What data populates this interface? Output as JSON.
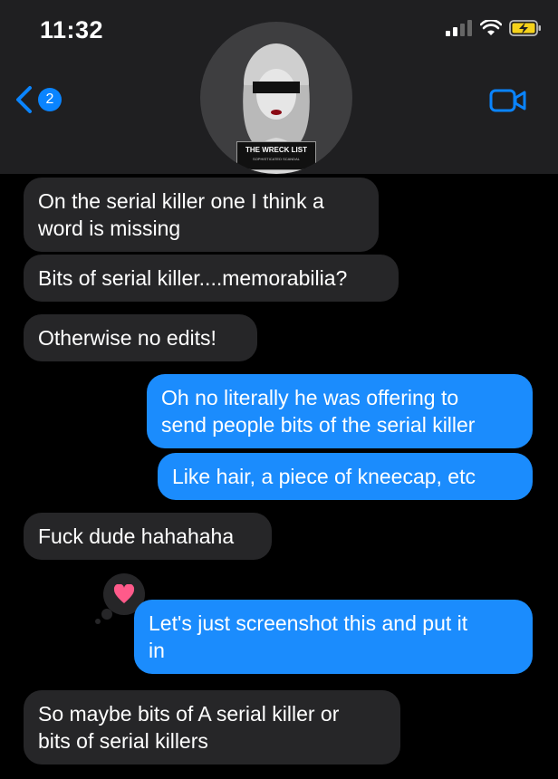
{
  "status_bar": {
    "time": "11:32"
  },
  "nav": {
    "unread_count": "2"
  },
  "contact": {
    "avatar_title": "THE WRECK LIST",
    "avatar_subtitle": "SOPHISTICATED SCANDAL"
  },
  "messages": [
    {
      "sender": "them",
      "text": "On the serial killer one I think a\nword is missing"
    },
    {
      "sender": "them",
      "text": "Bits of serial killer....memorabilia?"
    },
    {
      "sender": "them",
      "text": "Otherwise no edits!"
    },
    {
      "sender": "me",
      "text": "Oh no literally he was offering to\nsend people bits of the serial killer"
    },
    {
      "sender": "me",
      "text": "Like hair, a piece of kneecap, etc"
    },
    {
      "sender": "them",
      "text": "Fuck dude hahahaha"
    },
    {
      "sender": "me",
      "text": "Let's just screenshot this and put it\nin",
      "reaction": "heart-icon"
    },
    {
      "sender": "them",
      "text": "So maybe bits of A serial killer or\nbits of serial killers"
    }
  ],
  "colors": {
    "incoming_bubble": "#262628",
    "outgoing_bubble": "#1b8cfd",
    "header_bg": "#1f1f21",
    "accent": "#0a84ff",
    "reaction_heart": "#ff5a8a"
  }
}
